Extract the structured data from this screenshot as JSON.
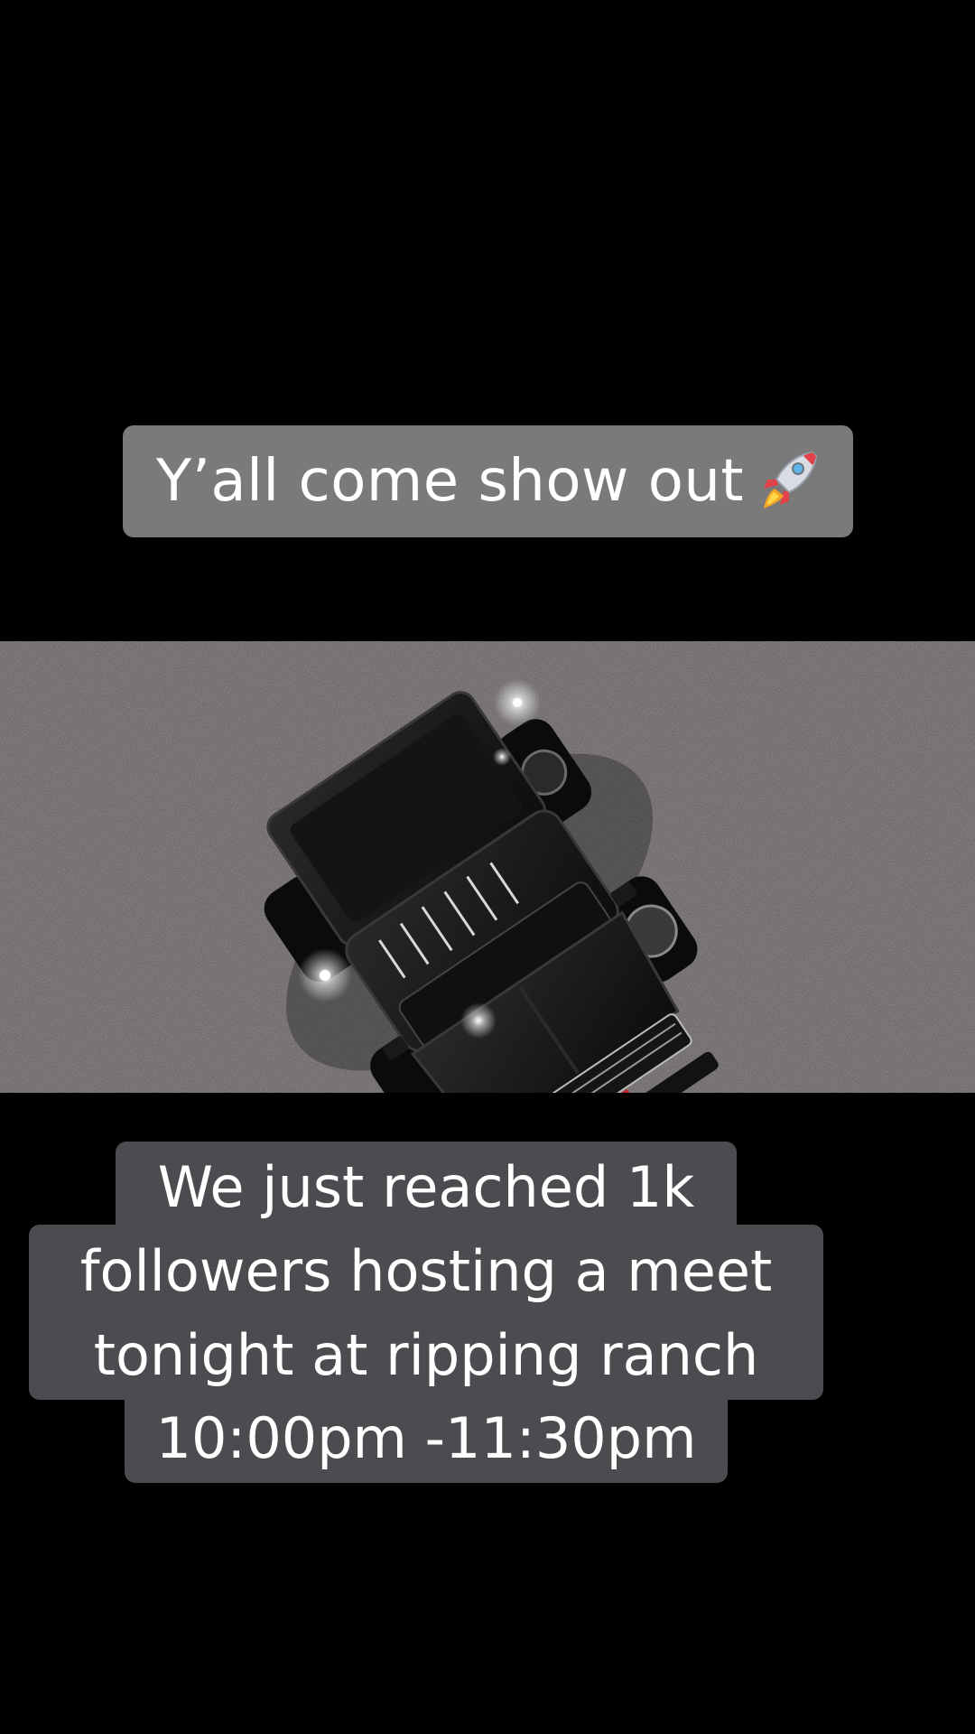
{
  "captions": {
    "top": "Y’all come show out",
    "top_emoji": "rocket-icon",
    "bottom_lines": [
      "We just reached 1k",
      "followers hosting a meet",
      "tonight at ripping ranch",
      "10:00pm -11:30pm"
    ]
  },
  "video": {
    "subject": "black lifted pickup truck on gravel",
    "colors": {
      "ground": "#6e6968",
      "truck": "#1b1a1b",
      "caption_top_bg": "#7a7a7a",
      "caption_bottom_bg": "#4b4c4f"
    }
  }
}
